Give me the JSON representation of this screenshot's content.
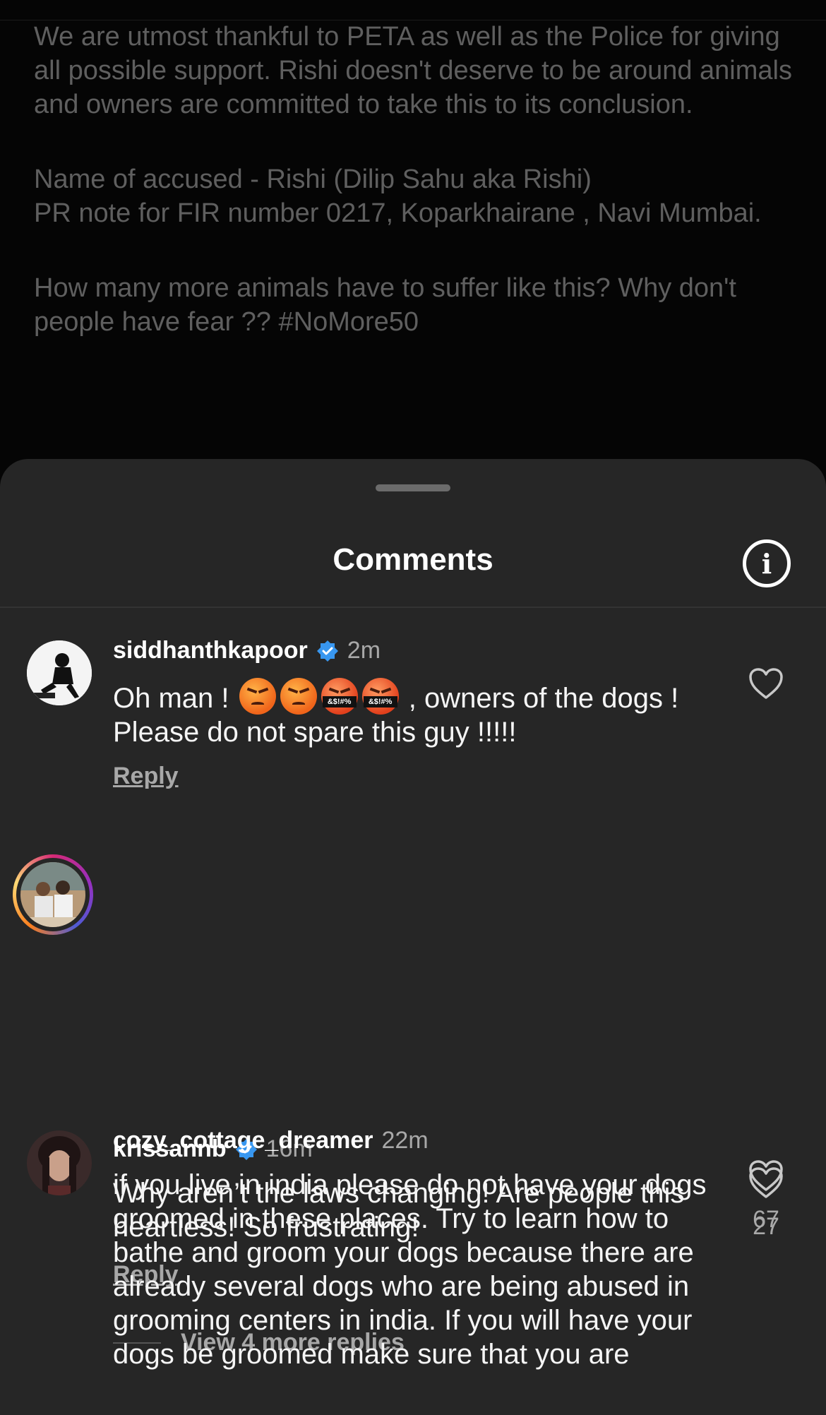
{
  "post": {
    "paragraphs": [
      "We are utmost thankful to PETA as well as the Police for giving all possible support. Rishi doesn't deserve to be around animals and owners are committed to take this to its conclusion.",
      "Name of accused - Rishi (Dilip Sahu aka Rishi)\nPR note for FIR number 0217, Koparkhairane , Navi Mumbai.",
      "How many more animals have to suffer like this? Why don't people have fear ?? #NoMore50"
    ]
  },
  "sheet": {
    "title": "Comments",
    "info_icon": "info-icon"
  },
  "comments": [
    {
      "username": "siddhanthkapoor",
      "verified": true,
      "time": "2m",
      "text_before": "Oh man !",
      "emojis": [
        "angry-face",
        "angry-face",
        "cursing-face",
        "cursing-face"
      ],
      "text_after": " , owners of the dogs ! Please do not spare  this guy !!!!!",
      "reply_label": "Reply",
      "likes": ""
    },
    {
      "username": "krissannb",
      "verified": true,
      "time": "16m",
      "text": "Why aren’t the laws changing! Are people this heartless! So frustrating!",
      "reply_label": "Reply",
      "likes": "27",
      "view_replies_label": "View 4 more replies"
    },
    {
      "username": "cozy_cottage_dreamer",
      "verified": false,
      "time": "22m",
      "text": "if you live in india please do not have your dogs groomed in these places. Try to learn how to bathe and groom your dogs because there are already several dogs who are being abused in grooming centers in india. If you will have your dogs be groomed make sure that you are",
      "likes": "67"
    }
  ],
  "emoji_label": "&$!#%",
  "colors": {
    "sheet_bg": "#262626",
    "verified_blue": "#3897f0",
    "secondary_text": "#a8a8a8"
  }
}
